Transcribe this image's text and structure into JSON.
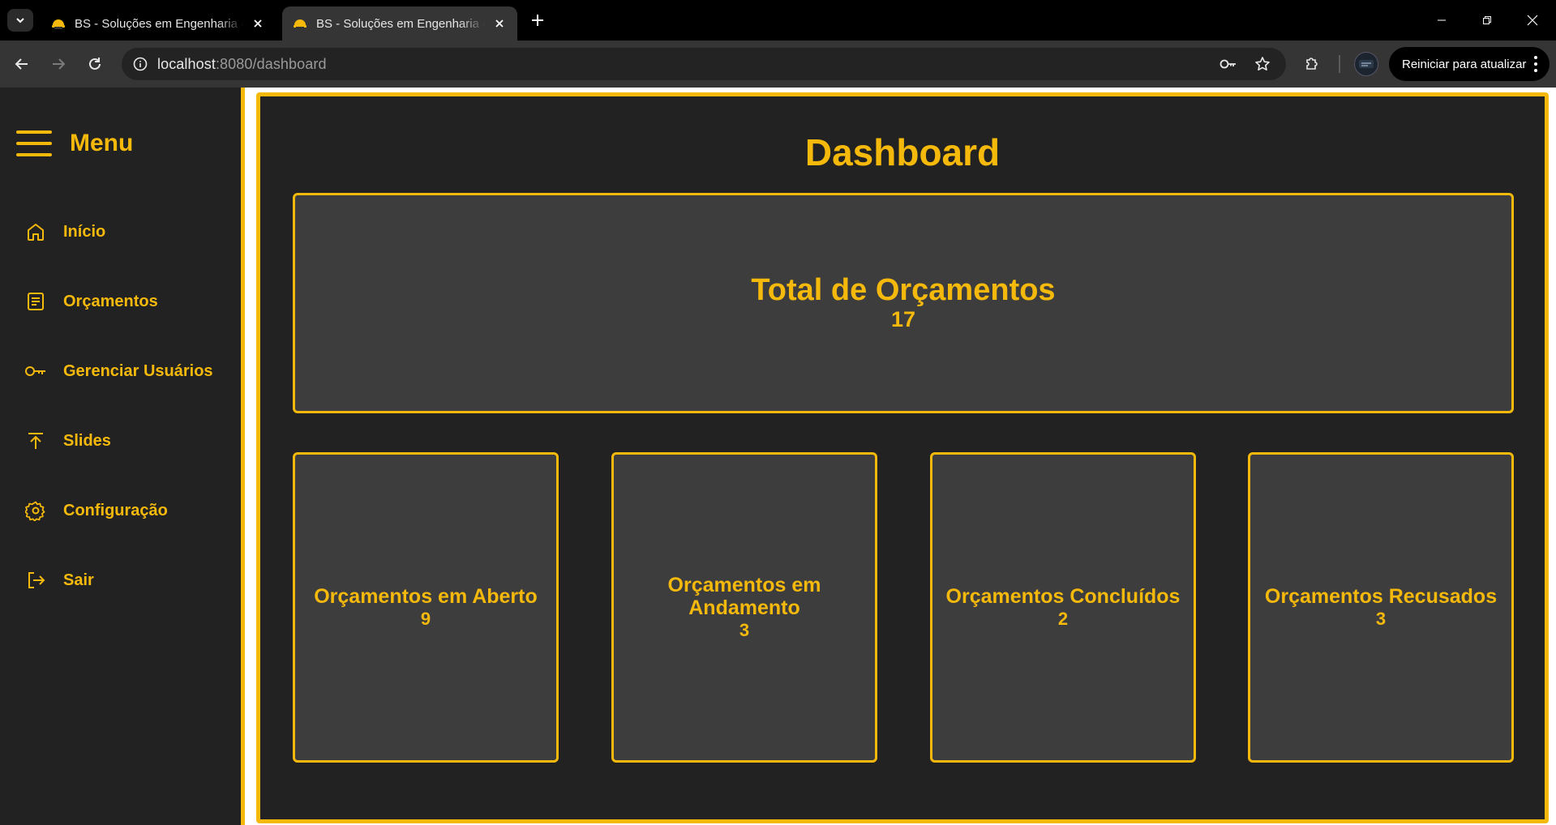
{
  "browser": {
    "tabs": [
      {
        "title": "BS - Soluções em Engenharia e",
        "active": false
      },
      {
        "title": "BS - Soluções em Engenharia e",
        "active": true
      }
    ],
    "url_host": "localhost",
    "url_path": ":8080/dashboard",
    "update_button_label": "Reiniciar para atualizar"
  },
  "sidebar": {
    "title": "Menu",
    "items": [
      {
        "label": "Início",
        "icon": "home-icon"
      },
      {
        "label": "Orçamentos",
        "icon": "document-icon"
      },
      {
        "label": "Gerenciar Usuários",
        "icon": "key-icon"
      },
      {
        "label": "Slides",
        "icon": "upload-icon"
      },
      {
        "label": "Configuração",
        "icon": "gear-icon"
      },
      {
        "label": "Sair",
        "icon": "logout-icon"
      }
    ]
  },
  "dashboard": {
    "title": "Dashboard",
    "total": {
      "label": "Total de Orçamentos",
      "value": "17"
    },
    "cards": [
      {
        "label": "Orçamentos em Aberto",
        "value": "9"
      },
      {
        "label": "Orçamentos em Andamento",
        "value": "3"
      },
      {
        "label": "Orçamentos Concluídos",
        "value": "2"
      },
      {
        "label": "Orçamentos Recusados",
        "value": "3"
      }
    ]
  },
  "colors": {
    "accent": "#f5b90c",
    "panel": "#222222",
    "card": "#3d3d3d"
  }
}
